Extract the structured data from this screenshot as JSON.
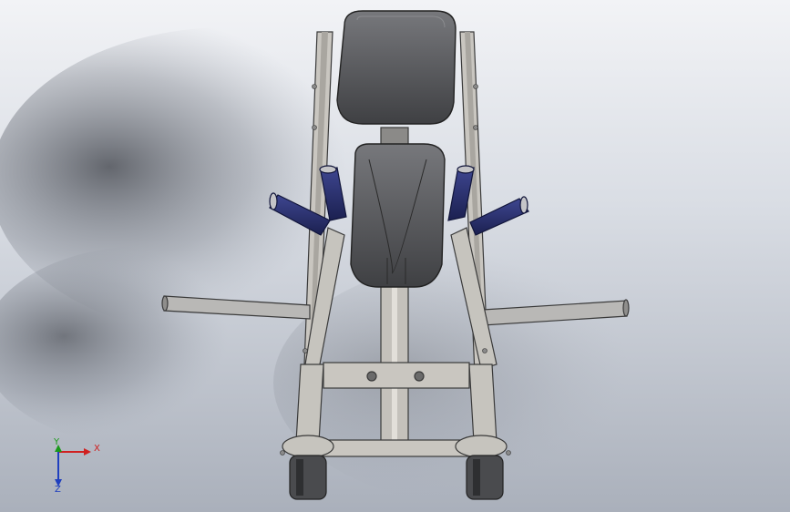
{
  "viewport": {
    "background_top": "#f2f3f6",
    "background_bottom": "#aab0bb",
    "frame_color": "#c9c6c0",
    "frame_edge": "#3a3a3a",
    "seat_color": "#5a5b5e",
    "grip_color": "#2a2f6e"
  },
  "triad": {
    "x_label": "X",
    "y_label": "Y",
    "z_label": "Z",
    "x_color": "#d02020",
    "y_color": "#1a9a1a",
    "z_color": "#1f3fbf"
  }
}
